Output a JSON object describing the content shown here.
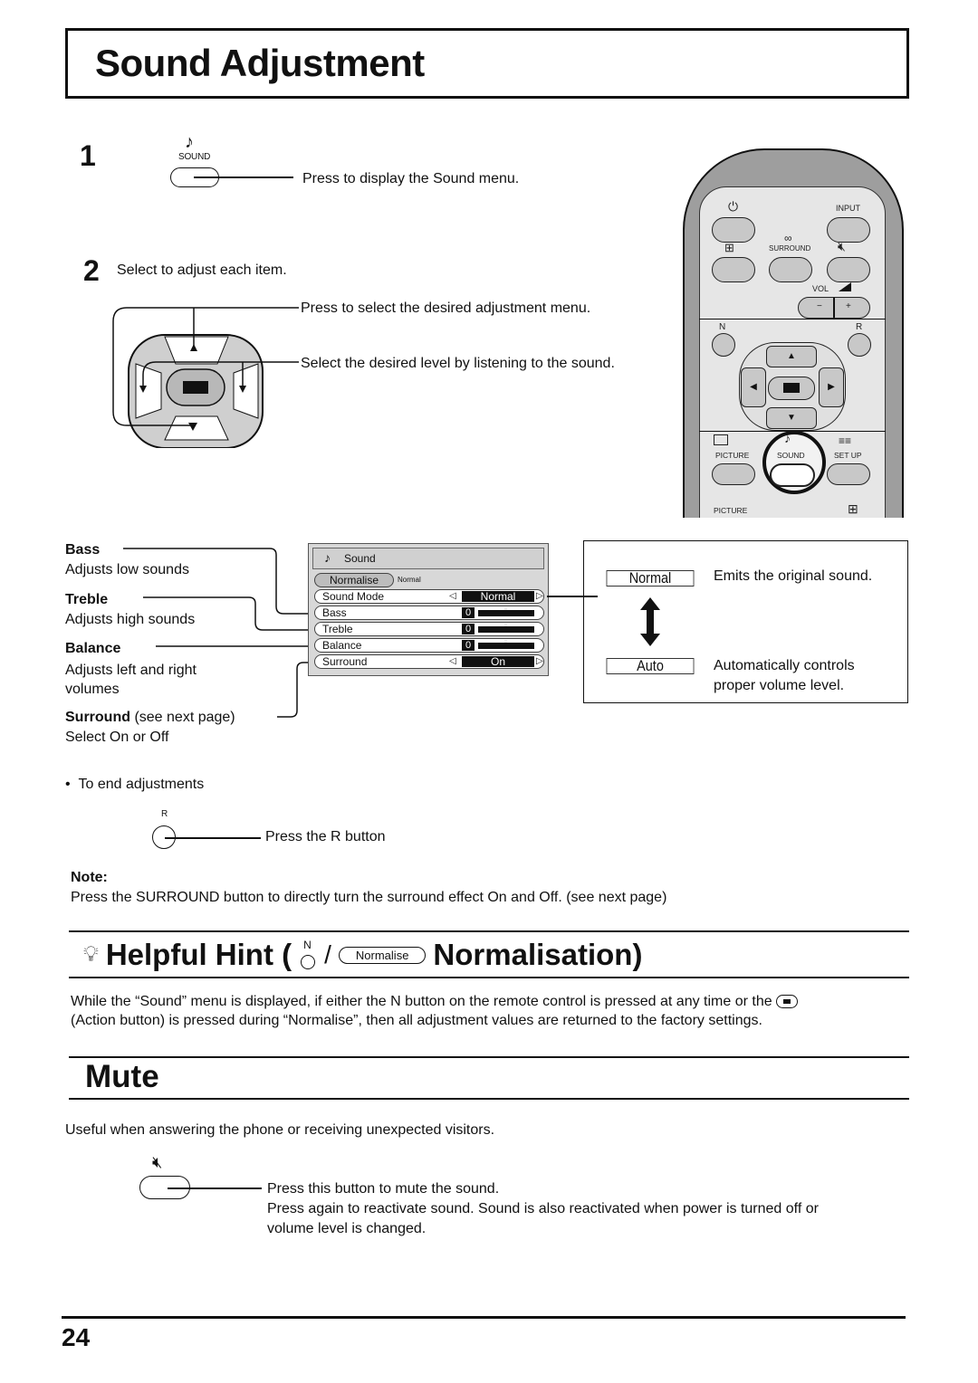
{
  "page": {
    "title": "Sound Adjustment",
    "page_number": "24"
  },
  "step1": {
    "number": "1",
    "button_label": "SOUND",
    "description": "Press to display the Sound menu."
  },
  "step2": {
    "number": "2",
    "intro": "Select to adjust each item.",
    "updown_text": "Press to select the desired adjustment menu.",
    "leftright_text": "Select the desired level by listening to the sound."
  },
  "remote": {
    "labels": {
      "input": "INPUT",
      "surround": "SURROUND",
      "vol": "VOL",
      "minus": "−",
      "plus": "+",
      "n": "N",
      "r": "R",
      "picture": "PICTURE",
      "sound": "SOUND",
      "setup": "SET UP",
      "picture2": "PICTURE"
    }
  },
  "items": [
    {
      "name": "Bass",
      "desc": "Adjusts low sounds",
      "note": ""
    },
    {
      "name": "Treble",
      "desc": "Adjusts high sounds",
      "note": ""
    },
    {
      "name": "Balance",
      "desc": "Adjusts left and right volumes",
      "note": ""
    },
    {
      "name": "Surround",
      "desc": "Select On or Off",
      "note": " (see next page)"
    }
  ],
  "osd": {
    "title": "Sound",
    "normalise_label": "Normalise",
    "normalise_value": "Normal",
    "rows": [
      {
        "label": "Sound Mode",
        "value": "Normal",
        "type": "select"
      },
      {
        "label": "Bass",
        "value": "0",
        "type": "slider",
        "level": 0.5
      },
      {
        "label": "Treble",
        "value": "0",
        "type": "slider",
        "level": 0.5
      },
      {
        "label": "Balance",
        "value": "0",
        "type": "slider",
        "level": 0.5
      },
      {
        "label": "Surround",
        "value": "On",
        "type": "select"
      }
    ]
  },
  "sound_mode": {
    "options": [
      {
        "label": "Normal",
        "desc": "Emits the original sound."
      },
      {
        "label": "Auto",
        "desc": "Automatically controls proper volume level."
      }
    ]
  },
  "end": {
    "bullet": "To end adjustments",
    "button_label": "R",
    "description": "Press the R button"
  },
  "note": {
    "heading": "Note:",
    "text": "Press the SURROUND button to directly turn the surround effect On and Off. (see next page)"
  },
  "hint": {
    "prefix": "Helpful Hint (",
    "n_label": "N",
    "slash": "/",
    "pill_label": "Normalise",
    "suffix": "Normalisation)",
    "line1": "While the “Sound” menu is displayed, if either the N button on the remote control is pressed at any time or the",
    "line2": "(Action button) is pressed during “Normalise”, then all adjustment values are returned to the factory settings."
  },
  "mute": {
    "title": "Mute",
    "intro": "Useful when answering the phone or receiving unexpected visitors.",
    "line1": "Press this button to mute the sound.",
    "line2": "Press again to reactivate sound. Sound is also reactivated when power is turned off or",
    "line3": "volume level is changed."
  }
}
